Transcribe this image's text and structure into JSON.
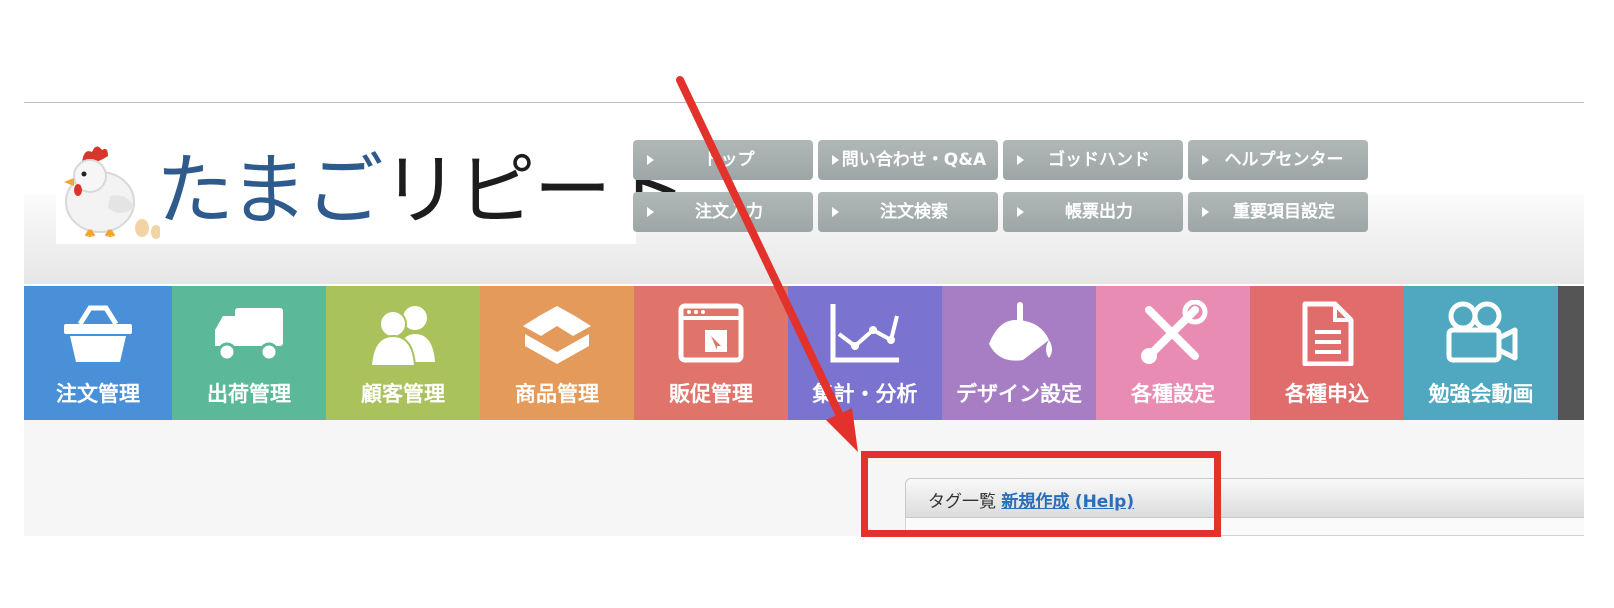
{
  "app": {
    "logo_text_blue": "たまご",
    "logo_text_black": "リピート"
  },
  "quick_links": [
    {
      "label": "トップ"
    },
    {
      "label": "問い合わせ・Q&A"
    },
    {
      "label": "ゴッドハンド"
    },
    {
      "label": "ヘルプセンター"
    },
    {
      "label": "注文入力"
    },
    {
      "label": "注文検索"
    },
    {
      "label": "帳票出力"
    },
    {
      "label": "重要項目設定"
    }
  ],
  "nav": [
    {
      "label": "注文管理",
      "icon": "basket-icon",
      "color": "#4a90d9"
    },
    {
      "label": "出荷管理",
      "icon": "truck-icon",
      "color": "#5bb99a"
    },
    {
      "label": "顧客管理",
      "icon": "users-icon",
      "color": "#a9c25b"
    },
    {
      "label": "商品管理",
      "icon": "box-icon",
      "color": "#e39a5a"
    },
    {
      "label": "販促管理",
      "icon": "browser-icon",
      "color": "#e0736a"
    },
    {
      "label": "集計・分析",
      "icon": "line-chart-icon",
      "color": "#7b73d0"
    },
    {
      "label": "デザイン設定",
      "icon": "paint-bucket-icon",
      "color": "#a77ec4"
    },
    {
      "label": "各種設定",
      "icon": "tools-icon",
      "color": "#e88cb4"
    },
    {
      "label": "各種申込",
      "icon": "document-icon",
      "color": "#e06d6b"
    },
    {
      "label": "勉強会動画",
      "icon": "video-camera-icon",
      "color": "#4fa8bf"
    }
  ],
  "panel": {
    "title": "タグ一覧",
    "new_link": "新規作成",
    "help_link": "(Help)"
  },
  "annotation": {
    "color": "#e3322b"
  }
}
